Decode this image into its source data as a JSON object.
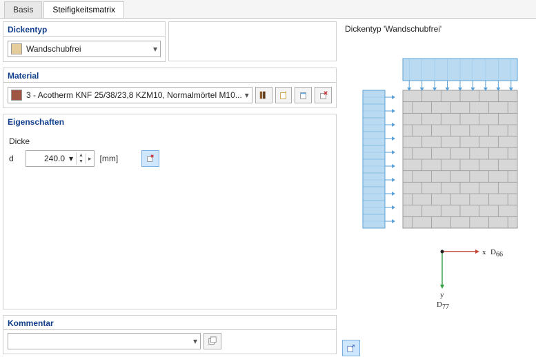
{
  "tabs": {
    "basis": "Basis",
    "steif": "Steifigkeitsmatrix"
  },
  "dickentyp": {
    "legend": "Dickentyp",
    "value": "Wandschubfrei"
  },
  "material": {
    "legend": "Material",
    "value": "3 - Acotherm KNF 25/38/23,8 KZM10, Normalmörtel M10..."
  },
  "eigenschaften": {
    "legend": "Eigenschaften",
    "dicke_label": "Dicke",
    "d_symbol": "d",
    "d_value": "240.0",
    "unit": "[mm]"
  },
  "kommentar": {
    "legend": "Kommentar",
    "value": ""
  },
  "preview": {
    "title_prefix": "Dickentyp  ",
    "title_quote": "'Wandschubfrei'",
    "x": "x",
    "y": "y",
    "d66": "D",
    "d66s": "66",
    "d77": "D",
    "d77s": "77"
  },
  "colors": {
    "load": "#b9daf1",
    "loadStroke": "#5aa0d6",
    "wall": "#d7d7d7",
    "wallStroke": "#9a9a9a",
    "axisGreen": "#2e9e3f",
    "axisRed": "#c24a3a"
  }
}
